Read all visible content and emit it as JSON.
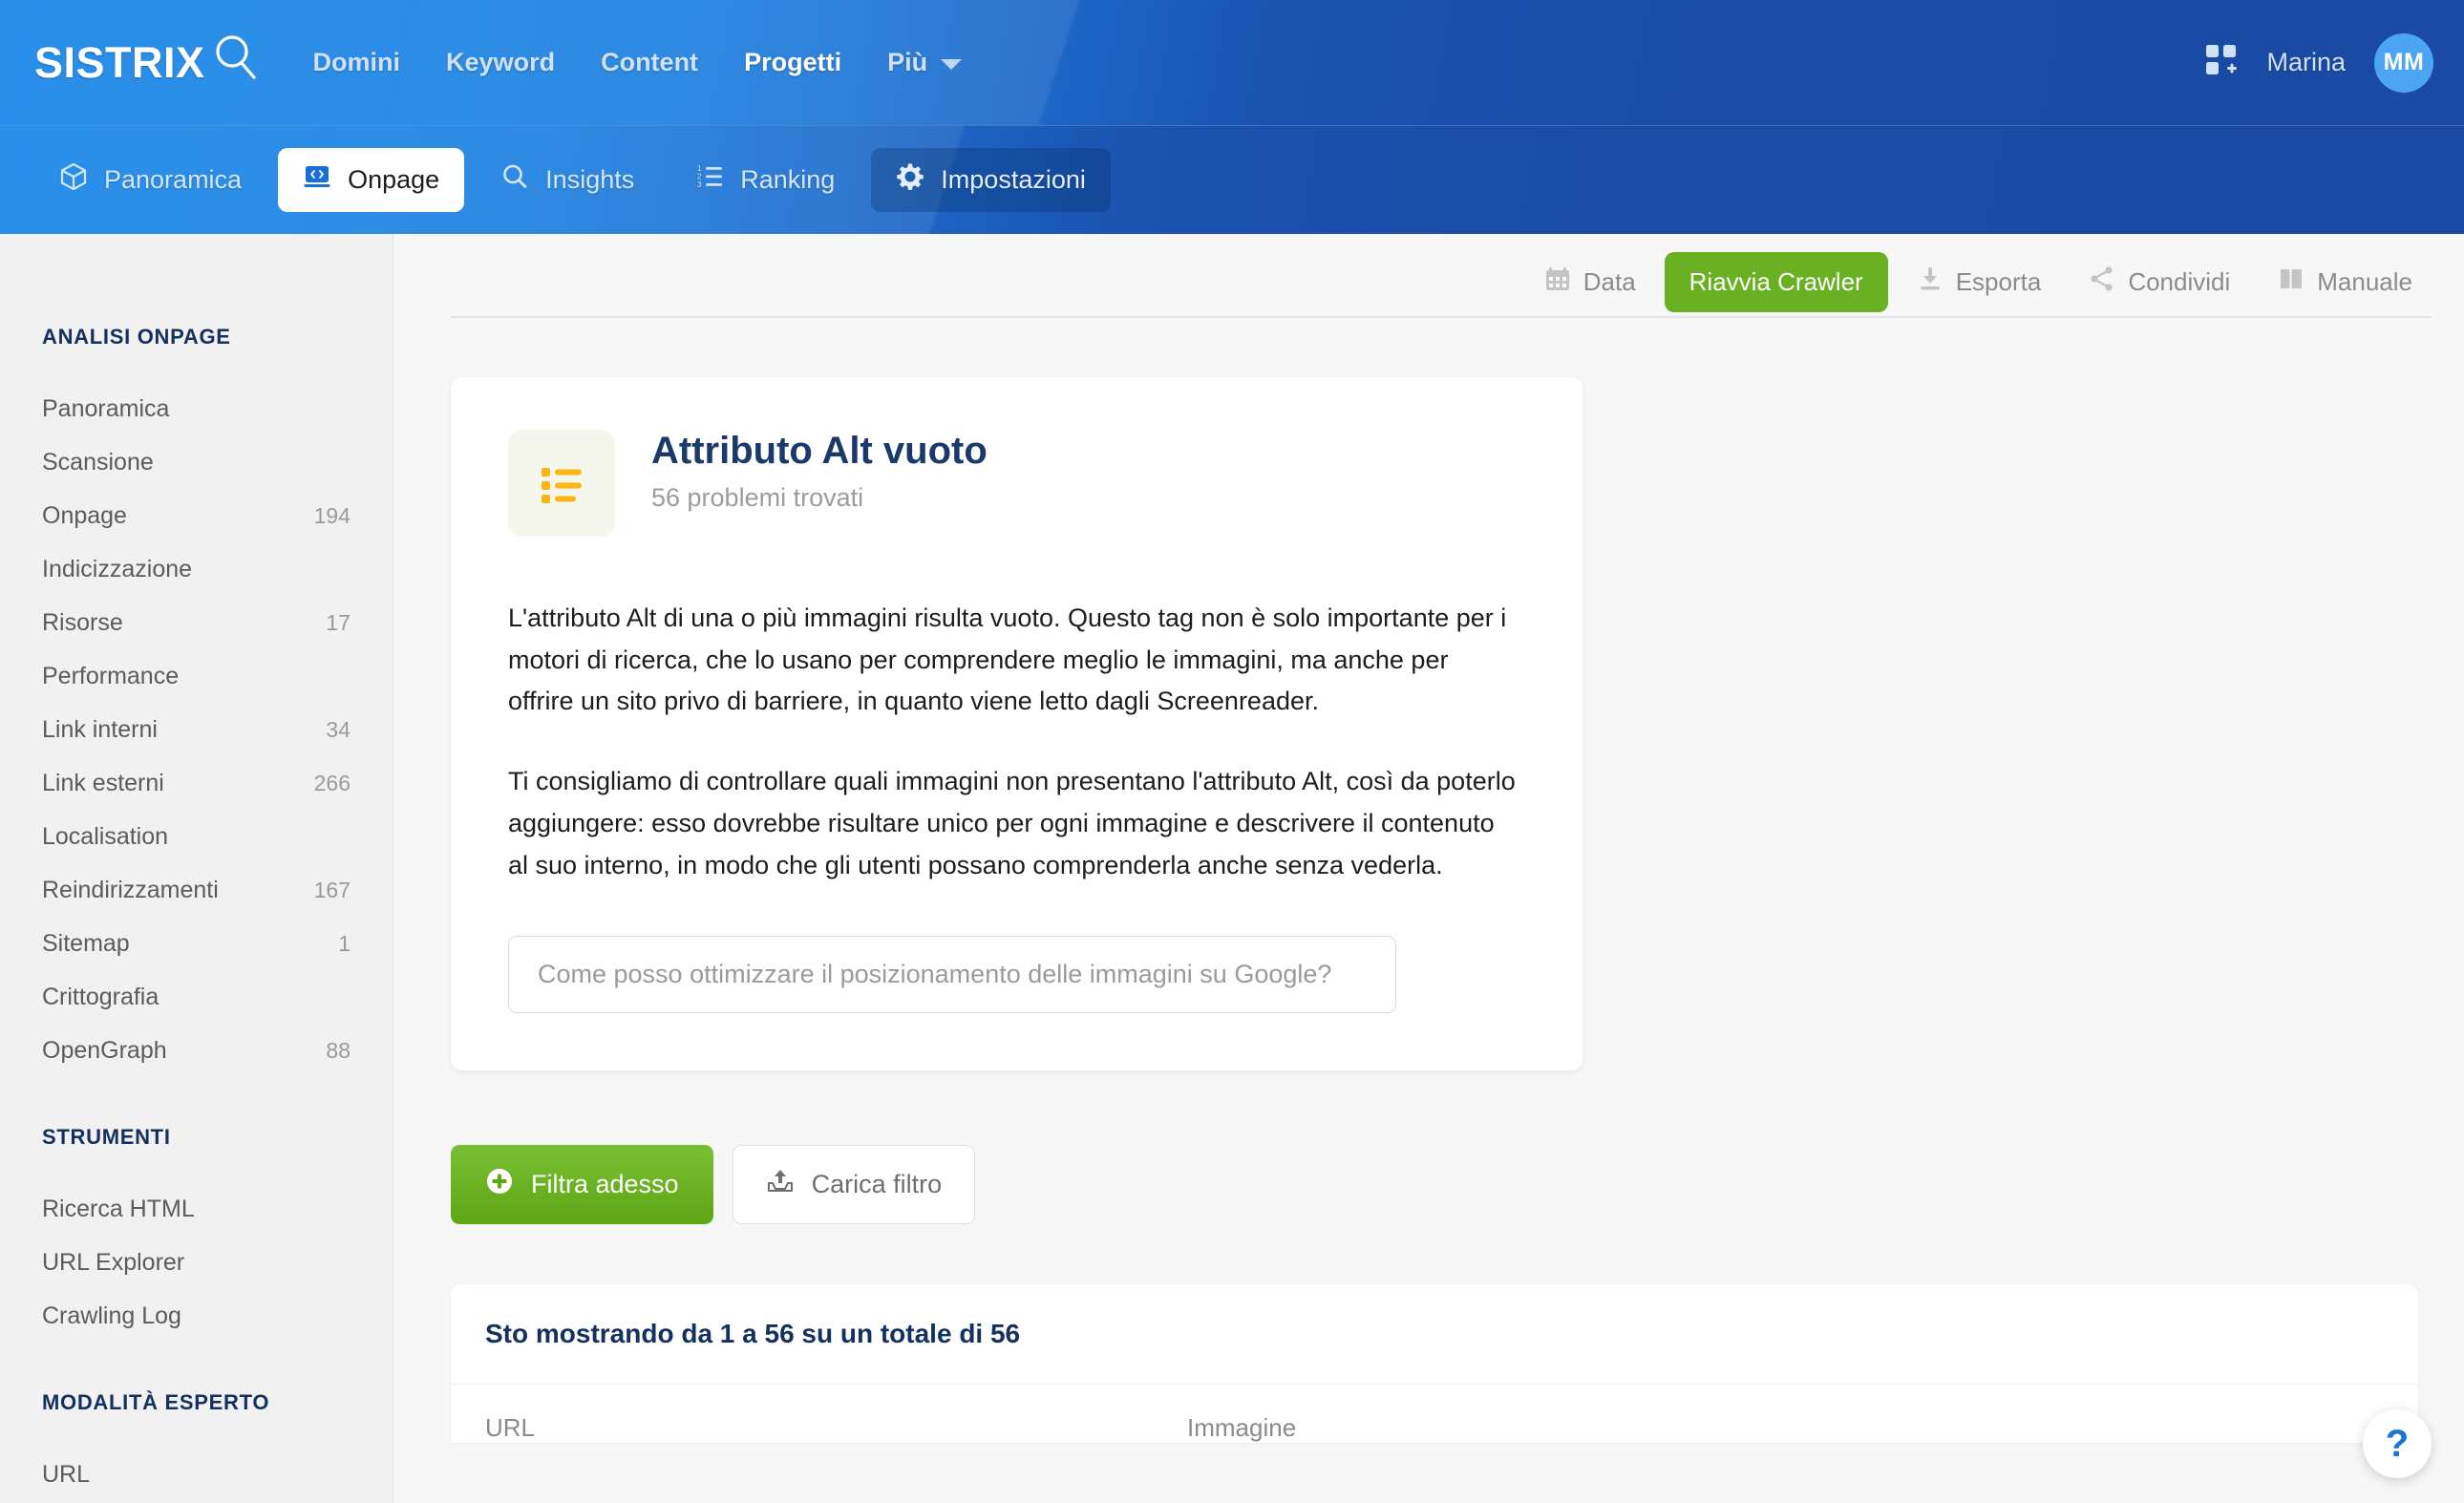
{
  "brand": {
    "name": "SISTRIX",
    "logo_icon": "magnifier-icon"
  },
  "topnav": {
    "items": [
      {
        "label": "Domini",
        "active": false
      },
      {
        "label": "Keyword",
        "active": false
      },
      {
        "label": "Content",
        "active": false
      },
      {
        "label": "Progetti",
        "active": true
      },
      {
        "label": "Più",
        "active": false,
        "caret": true
      }
    ],
    "apps_icon": "apps-grid-icon",
    "user_name": "Marina",
    "avatar_initials": "MM"
  },
  "subnav": {
    "items": [
      {
        "label": "Panoramica",
        "icon": "cube-icon",
        "state": "default"
      },
      {
        "label": "Onpage",
        "icon": "monitor-code-icon",
        "state": "active-white"
      },
      {
        "label": "Insights",
        "icon": "search-icon",
        "state": "default"
      },
      {
        "label": "Ranking",
        "icon": "ordered-list-icon",
        "state": "default"
      },
      {
        "label": "Impostazioni",
        "icon": "gear-icon",
        "state": "active-dark"
      }
    ]
  },
  "sidebar": {
    "sections": [
      {
        "title": "ANALISI ONPAGE",
        "items": [
          {
            "label": "Panoramica",
            "count": ""
          },
          {
            "label": "Scansione",
            "count": ""
          },
          {
            "label": "Onpage",
            "count": "194"
          },
          {
            "label": "Indicizzazione",
            "count": ""
          },
          {
            "label": "Risorse",
            "count": "17"
          },
          {
            "label": "Performance",
            "count": ""
          },
          {
            "label": "Link interni",
            "count": "34"
          },
          {
            "label": "Link esterni",
            "count": "266"
          },
          {
            "label": "Localisation",
            "count": ""
          },
          {
            "label": "Reindirizzamenti",
            "count": "167"
          },
          {
            "label": "Sitemap",
            "count": "1"
          },
          {
            "label": "Crittografia",
            "count": ""
          },
          {
            "label": "OpenGraph",
            "count": "88"
          }
        ]
      },
      {
        "title": "STRUMENTI",
        "items": [
          {
            "label": "Ricerca HTML",
            "count": ""
          },
          {
            "label": "URL Explorer",
            "count": ""
          },
          {
            "label": "Crawling Log",
            "count": ""
          }
        ]
      },
      {
        "title": "MODALITÀ ESPERTO",
        "items": [
          {
            "label": "URL",
            "count": ""
          }
        ]
      }
    ]
  },
  "toolbar": {
    "date_label": "Data",
    "date_icon": "calendar-icon",
    "restart_label": "Riavvia Crawler",
    "export_label": "Esporta",
    "export_icon": "download-icon",
    "share_label": "Condividi",
    "share_icon": "share-icon",
    "manual_label": "Manuale",
    "manual_icon": "book-icon"
  },
  "issue_card": {
    "icon": "bullet-list-icon",
    "title": "Attributo Alt vuoto",
    "subtitle": "56 problemi trovati",
    "paragraphs": [
      "L'attributo Alt di una o più immagini risulta vuoto. Questo tag non è solo importante per i motori di ricerca, che lo usano per comprendere meglio le immagini, ma anche per offrire un sito privo di barriere, in quanto viene letto dagli Screenreader.",
      "Ti consigliamo di controllare quali immagini non presentano l'attributo Alt, così da poterlo aggiungere: esso dovrebbe risultare unico per ogni immagine e descrivere il contenuto al suo interno, in modo che gli utenti possano comprenderla anche senza vederla."
    ],
    "question_prompt": "Come posso ottimizzare il posizionamento delle immagini su Google?"
  },
  "filters": {
    "apply_label": "Filtra adesso",
    "apply_icon": "plus-circle-icon",
    "load_label": "Carica filtro",
    "load_icon": "upload-tray-icon"
  },
  "results": {
    "summary": "Sto mostrando da 1 a 56 su un totale di 56",
    "columns": [
      "URL",
      "Immagine"
    ]
  },
  "help": {
    "label": "?",
    "icon": "question-mark-icon"
  },
  "colors": {
    "brand_blue": "#1a7fe0",
    "brand_dark_blue": "#1a4aa3",
    "accent_green": "#6ab023",
    "title_navy": "#1b3a6b",
    "icon_yellow": "#f7b500"
  }
}
